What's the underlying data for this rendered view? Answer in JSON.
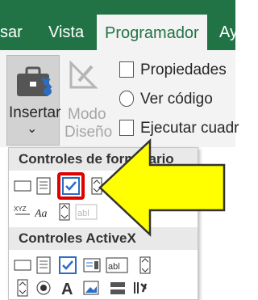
{
  "tabs": [
    {
      "label": "sar"
    },
    {
      "label": "Vista"
    },
    {
      "label": "Programador"
    },
    {
      "label": "Ay"
    }
  ],
  "ribbon": {
    "insertar_label": "Insertar",
    "insertar_caret": "⌄",
    "modo_line1": "Modo",
    "modo_line2": "Diseño",
    "propiedades": "Propiedades",
    "ver_codigo": "Ver código",
    "ejecutar": "Ejecutar cuadr"
  },
  "dropdown": {
    "section_form": "Controles de formulario",
    "section_activex": "Controles ActiveX"
  },
  "colors": {
    "excel_green": "#217346",
    "highlight_red": "#e00000",
    "arrow_yellow": "#ffff00",
    "check_blue": "#2b6cc4"
  },
  "icons": [
    "briefcase-icon",
    "design-ruler-icon",
    "properties-icon",
    "view-code-icon",
    "run-dialog-icon",
    "checkbox-icon",
    "arrow-pointer-icon"
  ]
}
